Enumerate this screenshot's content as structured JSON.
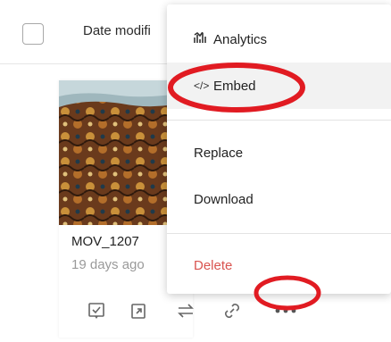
{
  "header": {
    "date_column": "Date modifi"
  },
  "card": {
    "file_name": "MOV_1207",
    "modified": "19 days ago"
  },
  "actions": [
    "select-check-icon",
    "open-external-icon",
    "swap-icon",
    "link-icon",
    "more-options-icon"
  ],
  "menu": {
    "items": [
      {
        "label": "Analytics",
        "icon": "analytics-icon"
      },
      {
        "label": "Embed",
        "icon": "code-icon",
        "glyph": "</>"
      },
      {
        "label": "Replace"
      },
      {
        "label": "Download"
      },
      {
        "label": "Delete",
        "color": "#d9534f"
      }
    ]
  },
  "colors": {
    "annotation": "#e11b22",
    "danger": "#d9534f"
  }
}
